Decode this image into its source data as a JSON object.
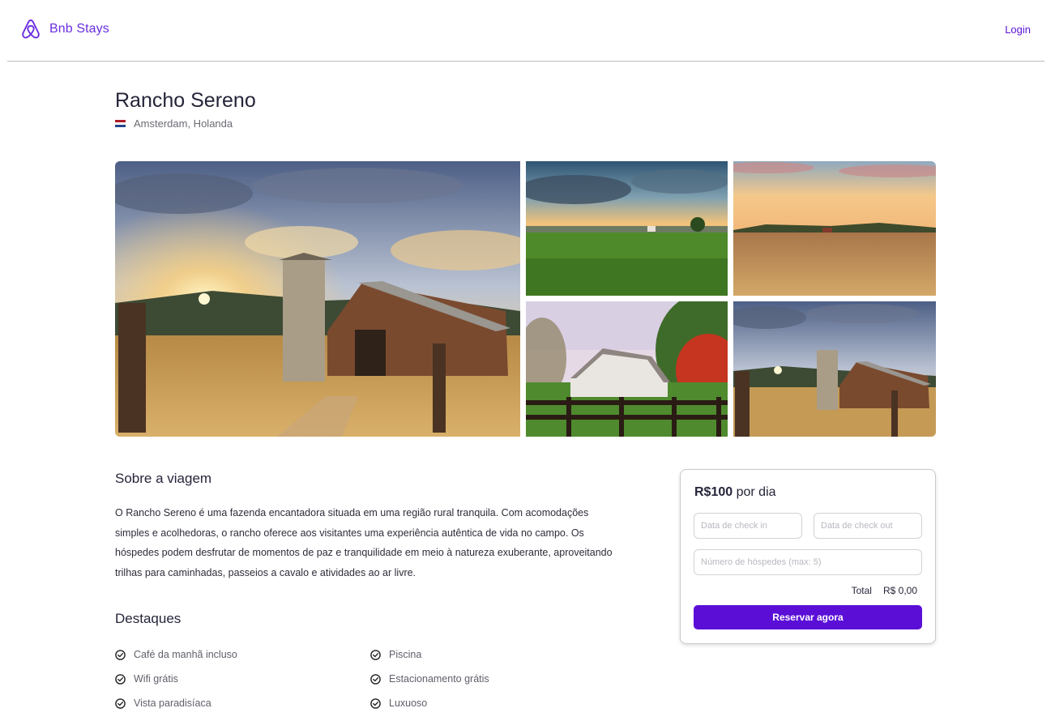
{
  "header": {
    "brand": "Bnb Stays",
    "login_label": "Login"
  },
  "listing": {
    "title": "Rancho Sereno",
    "location": "Amsterdam, Holanda",
    "flag_colors": [
      "#ae1c28",
      "#ffffff",
      "#21468b"
    ]
  },
  "about": {
    "title": "Sobre a viagem",
    "text": "O Rancho Sereno é uma fazenda encantadora situada em uma região rural tranquila. Com acomodações simples e acolhedoras, o rancho oferece aos visitantes uma experiência autêntica de vida no campo. Os hóspedes podem desfrutar de momentos de paz e tranquilidade em meio à natureza exuberante, aproveitando trilhas para caminhadas, passeios a cavalo e atividades ao ar livre."
  },
  "highlights": {
    "title": "Destaques",
    "items": [
      "Café da manhã incluso",
      "Piscina",
      "Wifi grátis",
      "Estacionamento grátis",
      "Vista paradisíaca",
      "Luxuoso"
    ]
  },
  "booking": {
    "price": "R$100",
    "price_unit": "por dia",
    "checkin_placeholder": "Data de check in",
    "checkout_placeholder": "Data de check out",
    "guests_placeholder": "Número de hóspedes (max: 5)",
    "total_label": "Total",
    "total_value": "R$ 0,00",
    "button_label": "Reservar agora"
  },
  "colors": {
    "accent": "#5b0fd6",
    "brand": "#6b2ee0"
  }
}
